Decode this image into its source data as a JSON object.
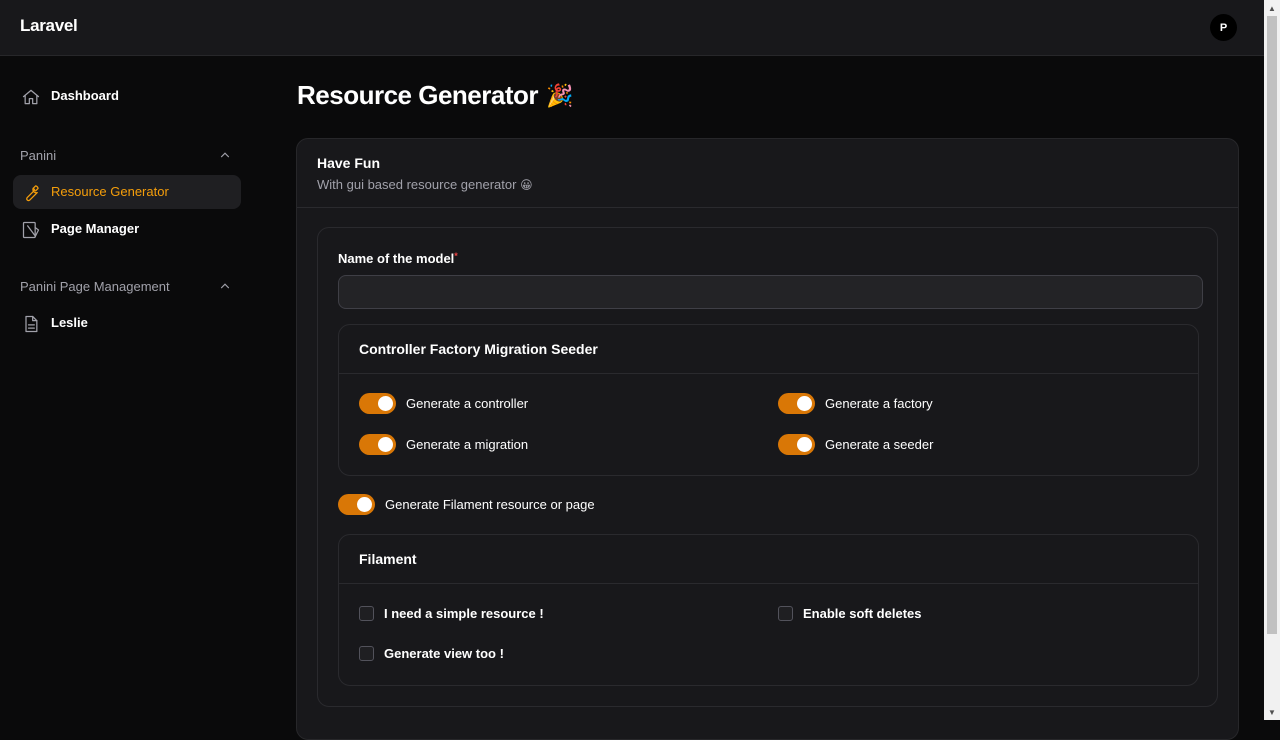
{
  "app": {
    "brand": "Laravel",
    "avatar_initial": "P",
    "accent": "#f59e0b",
    "toggle_color": "#d97706"
  },
  "sidebar": {
    "dashboard": {
      "label": "Dashboard",
      "icon": "home-icon"
    },
    "groups": [
      {
        "label": "Panini",
        "items": [
          {
            "label": "Resource Generator",
            "icon": "wrench-icon",
            "active": true
          },
          {
            "label": "Page Manager",
            "icon": "page-manager-icon",
            "active": false
          }
        ]
      },
      {
        "label": "Panini Page Management",
        "items": [
          {
            "label": "Leslie",
            "icon": "document-icon",
            "active": false
          }
        ]
      }
    ]
  },
  "page": {
    "title": "Resource Generator",
    "title_emoji": "🎉",
    "card": {
      "title": "Have Fun",
      "description": "With gui based resource generator",
      "description_emoji": "😀"
    },
    "form": {
      "model_label": "Name of the model",
      "required_mark": "*",
      "model_value": "",
      "sections": {
        "cfms": {
          "title": "Controller Factory Migration Seeder",
          "toggles": [
            {
              "label": "Generate a controller",
              "on": true
            },
            {
              "label": "Generate a factory",
              "on": true
            },
            {
              "label": "Generate a migration",
              "on": true
            },
            {
              "label": "Generate a seeder",
              "on": true
            }
          ]
        },
        "filament_toggle": {
          "label": "Generate Filament resource or page",
          "on": true
        },
        "filament": {
          "title": "Filament",
          "checkboxes": [
            {
              "label": "I need a simple resource !",
              "checked": false
            },
            {
              "label": "Enable soft deletes",
              "checked": false
            },
            {
              "label": "Generate view too !",
              "checked": false
            }
          ]
        }
      }
    }
  }
}
